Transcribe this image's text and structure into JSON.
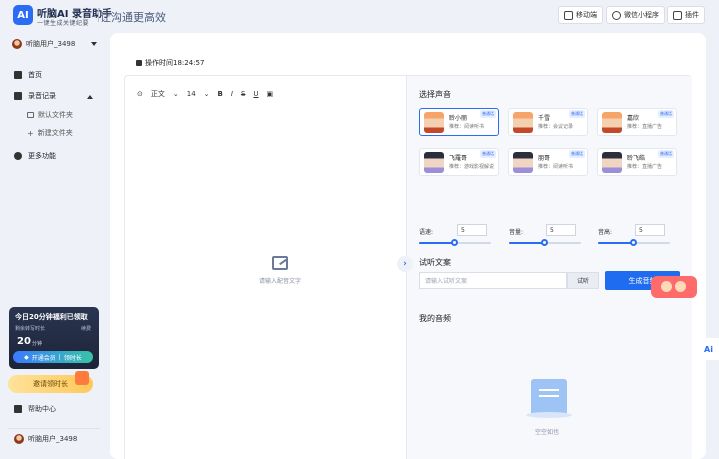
{
  "header": {
    "logo_text": "AI",
    "brand_name": "听脑AI 录音助手",
    "brand_tagline": "一键生成关键纪要",
    "slogan": "让沟通更高效",
    "mobile_label": "移动端",
    "miniprogram_label": "微信小程序",
    "plugin_label": "插件"
  },
  "sidebar": {
    "username": "听脑用户_3498",
    "items": {
      "home": "首页",
      "records": "录音记录",
      "default_folder": "默认文件夹",
      "new_folder": "新建文件夹",
      "more": "更多功能"
    },
    "promo": {
      "title": "今日20分钟福利已领取",
      "remaining_label": "剩余转写时长",
      "renew_label": "续费",
      "minutes": "20",
      "unit": "分钟",
      "open_vip": "开通会员",
      "get_time": "领时长"
    },
    "gift_label": "邀请领时长",
    "help_label": "帮助中心",
    "bottom_username": "听脑用户_3498"
  },
  "main": {
    "op_time": "操作时间18:24:57",
    "toolbar": {
      "style_value": "正文",
      "size_value": "14",
      "bold": "B",
      "italic": "I",
      "strike": "S",
      "underline": "U"
    },
    "editor_placeholder": "请输入配音文字",
    "expand_icon": "›",
    "right": {
      "select_voice_title": "选择声音",
      "voices": [
        {
          "name": "聆小丽",
          "desc": "推荐：阅读听书",
          "badge": "普通话",
          "gender": "f"
        },
        {
          "name": "千雪",
          "desc": "推荐：会议记录",
          "badge": "普通话",
          "gender": "f"
        },
        {
          "name": "嘉欣",
          "desc": "推荐：直播广告",
          "badge": "普通话",
          "gender": "f"
        },
        {
          "name": "飞羅哥",
          "desc": "推荐：游戏影视解说",
          "badge": "普通话",
          "gender": "m"
        },
        {
          "name": "朋哥",
          "desc": "推荐：阅读听书",
          "badge": "普通话",
          "gender": "m"
        },
        {
          "name": "聆飞皓",
          "desc": "推荐：直播广告",
          "badge": "普通话",
          "gender": "m"
        }
      ],
      "speed_label": "语速:",
      "speed_value": "5",
      "volume_label": "音量:",
      "volume_value": "5",
      "pitch_label": "音高:",
      "pitch_value": "5",
      "slider_levels": {
        "speed": 0.5,
        "volume": 0.5,
        "pitch": 0.5
      },
      "sample_title": "试听文案",
      "sample_placeholder": "请输入试听文案",
      "sample_button": "试听",
      "generate_button": "生成音频",
      "my_audio_title": "我的音频",
      "empty_text": "空空如也"
    }
  },
  "float": {
    "ai_label": "Ai"
  },
  "colors": {
    "accent": "#2a6cf6",
    "background": "#eef1f8"
  }
}
